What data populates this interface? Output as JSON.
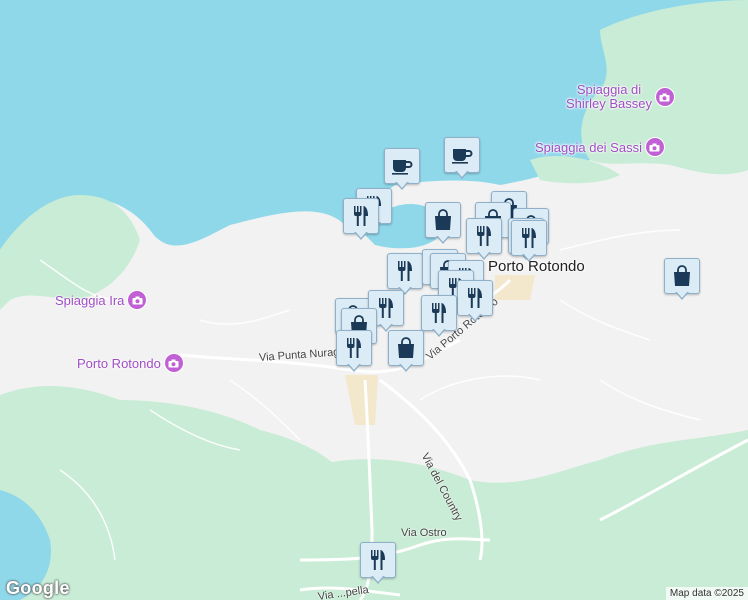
{
  "map": {
    "attribution": "Map data ©2025",
    "logo": "Google",
    "town": "Porto Rotondo",
    "places": [
      {
        "id": "shirley",
        "line1": "Spiaggia di",
        "line2": "Shirley Bassey"
      },
      {
        "id": "sassi",
        "line1": "Spiaggia dei Sassi"
      },
      {
        "id": "ira",
        "line1": "Spiaggia Ira"
      },
      {
        "id": "pr",
        "line1": "Porto Rotondo"
      }
    ],
    "roads": [
      {
        "id": "nuraghe",
        "text": "Via Punta Nuraghe"
      },
      {
        "id": "portorotondo",
        "text": "Via Porto Rotondo"
      },
      {
        "id": "country",
        "text": "Via del Country"
      },
      {
        "id": "ostro",
        "text": "Via Ostro"
      },
      {
        "id": "pella",
        "text": "Via ...pella"
      }
    ],
    "markers": [
      {
        "type": "cafe"
      },
      {
        "type": "cafe"
      },
      {
        "type": "restaurant"
      },
      {
        "type": "restaurant"
      },
      {
        "type": "shopping"
      },
      {
        "type": "shopping"
      },
      {
        "type": "shopping"
      },
      {
        "type": "shopping"
      },
      {
        "type": "shopping"
      },
      {
        "type": "restaurant"
      },
      {
        "type": "restaurant"
      },
      {
        "type": "restaurant"
      },
      {
        "type": "restaurant"
      },
      {
        "type": "shopping"
      },
      {
        "type": "restaurant"
      },
      {
        "type": "restaurant"
      },
      {
        "type": "restaurant"
      },
      {
        "type": "shopping"
      },
      {
        "type": "restaurant"
      },
      {
        "type": "restaurant"
      },
      {
        "type": "shopping"
      },
      {
        "type": "restaurant"
      }
    ],
    "colors": {
      "water": "#8fd8ea",
      "land": "#f2f2f3",
      "park": "#c8ecd5",
      "pin_icon": "#1b3a57",
      "poi": "#a04ec4"
    }
  }
}
